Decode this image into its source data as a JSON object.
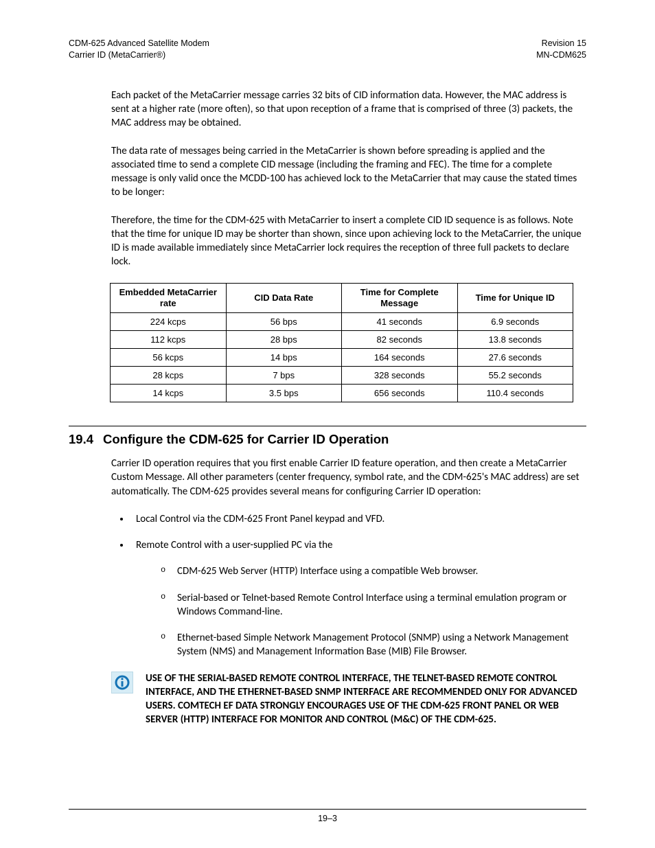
{
  "header": {
    "left_line1": "CDM-625 Advanced Satellite Modem",
    "left_line2": "Carrier ID (MetaCarrier®)",
    "right_line1": "Revision 15",
    "right_line2": "MN-CDM625"
  },
  "para1": "Each packet of the MetaCarrier message carries 32 bits of CID information data. However, the MAC address is sent at a higher rate (more often), so that upon reception of a frame that is comprised of three (3) packets, the MAC address may be obtained.",
  "para2": "The data rate of messages being carried in the MetaCarrier is shown before spreading is applied and the associated time to send a complete CID message (including the framing and FEC). The time for a complete message is only valid once the MCDD-100 has achieved lock to the MetaCarrier that may cause the stated times to be longer:",
  "para3": "Therefore, the time for the CDM-625 with MetaCarrier to insert a complete CID ID sequence is as follows. Note that the time for unique ID may be shorter than shown, since upon achieving lock to the MetaCarrier, the unique ID is made available immediately since MetaCarrier lock requires the reception of three full packets to declare lock.",
  "table": {
    "headers": [
      "Embedded MetaCarrier rate",
      "CID Data Rate",
      "Time for Complete Message",
      "Time for Unique ID"
    ],
    "rows": [
      [
        "224 kcps",
        "56 bps",
        "41 seconds",
        "6.9 seconds"
      ],
      [
        "112 kcps",
        "28 bps",
        "82 seconds",
        "13.8 seconds"
      ],
      [
        "56 kcps",
        "14 bps",
        "164 seconds",
        "27.6  seconds"
      ],
      [
        "28 kcps",
        "7 bps",
        "328 seconds",
        "55.2 seconds"
      ],
      [
        "14 kcps",
        "3.5 bps",
        "656 seconds",
        "110.4 seconds"
      ]
    ]
  },
  "section": {
    "number": "19.4",
    "title": "Configure the CDM-625 for Carrier ID Operation",
    "intro": "Carrier ID operation requires that you first enable Carrier ID feature operation, and then create a MetaCarrier Custom Message. All other parameters (center frequency, symbol rate, and the CDM-625's MAC address) are set automatically. The CDM-625 provides several means for configuring Carrier ID operation:",
    "bullet1": "Local Control via the CDM-625 Front Panel keypad and VFD.",
    "bullet2": "Remote Control with a user-supplied PC via the",
    "sub1": "CDM-625 Web Server (HTTP) Interface using a compatible Web browser.",
    "sub2": "Serial-based or Telnet-based Remote Control Interface using a terminal emulation program or Windows Command-line.",
    "sub3": "Ethernet-based Simple Network Management Protocol (SNMP) using a Network Management System (NMS) and Management Information Base (MIB) File Browser.",
    "note": "USE OF THE SERIAL-BASED REMOTE CONTROL INTERFACE, THE TELNET-BASED REMOTE CONTROL INTERFACE, AND THE ETHERNET-BASED SNMP INTERFACE ARE RECOMMENDED ONLY FOR ADVANCED USERS. COMTECH EF DATA STRONGLY ENCOURAGES USE OF THE CDM-625 FRONT PANEL OR WEB SERVER (HTTP) INTERFACE FOR MONITOR AND CONTROL (M&C) OF THE CDM-625."
  },
  "footer": "19–3"
}
